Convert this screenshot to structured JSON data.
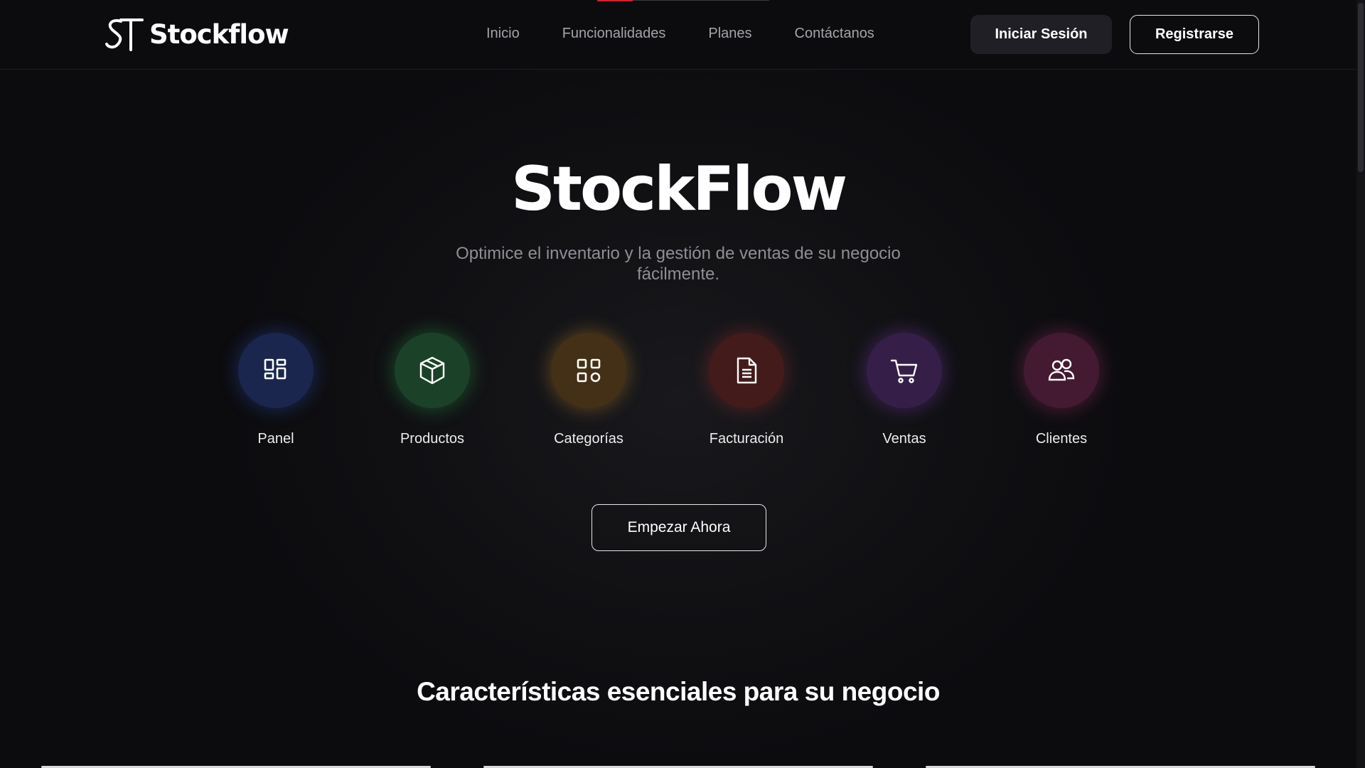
{
  "header": {
    "logo_text": "Stockflow",
    "nav": [
      {
        "label": "Inicio"
      },
      {
        "label": "Funcionalidades"
      },
      {
        "label": "Planes"
      },
      {
        "label": "Contáctanos"
      }
    ],
    "login_label": "Iniciar Sesión",
    "register_label": "Registrarse"
  },
  "hero": {
    "title": "StockFlow",
    "subtitle": "Optimice el inventario y la gestión de ventas de su negocio fácilmente."
  },
  "features": [
    {
      "label": "Panel",
      "icon": "dashboard-icon",
      "color": "#1c2a55"
    },
    {
      "label": "Productos",
      "icon": "box-icon",
      "color": "#1d4a2c"
    },
    {
      "label": "Categorías",
      "icon": "grid-icon",
      "color": "#4a3618"
    },
    {
      "label": "Facturación",
      "icon": "document-icon",
      "color": "#4a1e1e"
    },
    {
      "label": "Ventas",
      "icon": "cart-icon",
      "color": "#3b2250"
    },
    {
      "label": "Clientes",
      "icon": "users-icon",
      "color": "#4a1c36"
    }
  ],
  "cta_label": "Empezar Ahora",
  "section_title": "Características esenciales para su negocio",
  "colors": {
    "background": "#0c0c0f",
    "accent_indicator": "#d21f2b"
  }
}
